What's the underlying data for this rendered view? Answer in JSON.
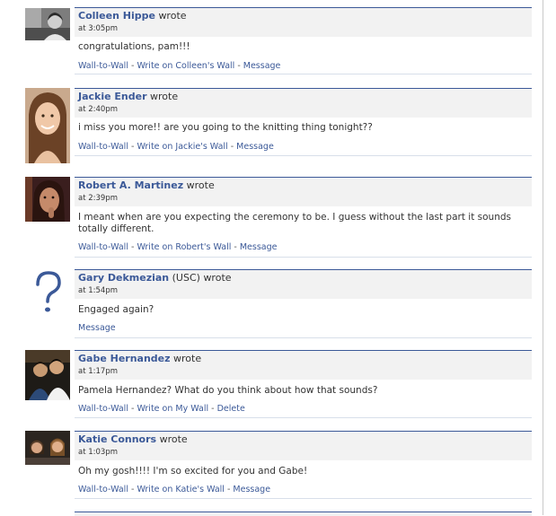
{
  "wall": {
    "wrote_label": "wrote",
    "posts": [
      {
        "author": "Colleen Hippe",
        "author_extra": "",
        "time": "at 3:05pm",
        "message": "congratulations, pam!!!",
        "links": [
          "Wall-to-Wall",
          "Write on Colleen's Wall",
          "Message"
        ],
        "avatar": "avatar-photo"
      },
      {
        "author": "Jackie Ender",
        "author_extra": "",
        "time": "at 2:40pm",
        "message": "i miss you more!! are you going to the knitting thing tonight??",
        "links": [
          "Wall-to-Wall",
          "Write on Jackie's Wall",
          "Message"
        ],
        "avatar": "avatar-photo"
      },
      {
        "author": "Robert A. Martinez",
        "author_extra": "",
        "time": "at 2:39pm",
        "message": "I meant when are you expecting the ceremony to be. I guess without the last part it sounds totally different.",
        "links": [
          "Wall-to-Wall",
          "Write on Robert's Wall",
          "Message"
        ],
        "avatar": "avatar-photo"
      },
      {
        "author": "Gary Dekmezian",
        "author_extra": " (USC)",
        "time": "at 1:54pm",
        "message": "Engaged again?",
        "links": [
          "Message"
        ],
        "avatar": "question-mark-icon"
      },
      {
        "author": "Gabe Hernandez",
        "author_extra": "",
        "time": "at 1:17pm",
        "message": "Pamela Hernandez? What do you think about how that sounds?",
        "links": [
          "Wall-to-Wall",
          "Write on My Wall",
          "Delete"
        ],
        "avatar": "avatar-photo"
      },
      {
        "author": "Katie Connors",
        "author_extra": "",
        "time": "at 1:03pm",
        "message": "Oh my gosh!!!! I'm so excited for you and Gabe!",
        "links": [
          "Wall-to-Wall",
          "Write on Katie's Wall",
          "Message"
        ],
        "avatar": "avatar-photo"
      }
    ]
  }
}
